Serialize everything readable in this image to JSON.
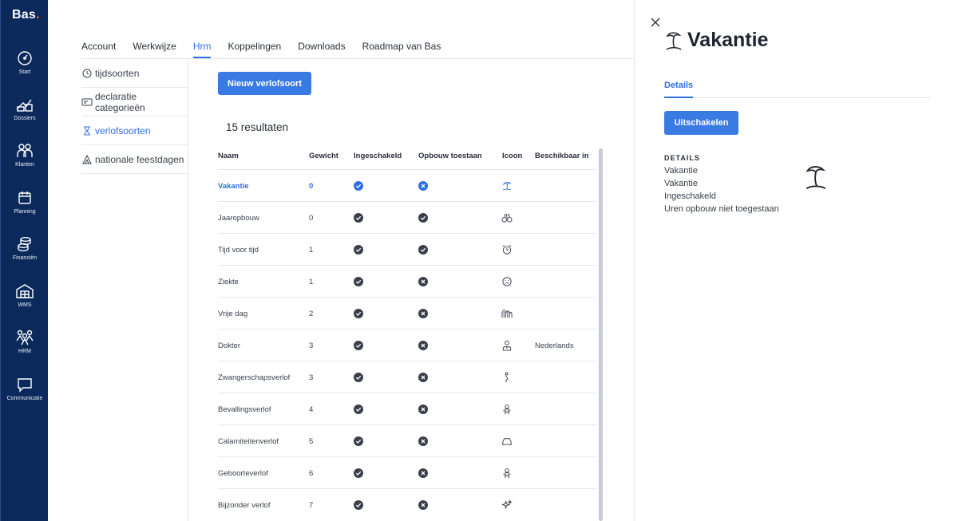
{
  "brand": {
    "logo": "Bas",
    "logo_dot": "."
  },
  "leftnav": [
    {
      "label": "Start",
      "icon": "speedometer-icon"
    },
    {
      "label": "Dossiers",
      "icon": "dossiers-icon"
    },
    {
      "label": "Klanten",
      "icon": "customers-icon"
    },
    {
      "label": "Planning",
      "icon": "calendar-icon"
    },
    {
      "label": "Financiën",
      "icon": "coins-icon"
    },
    {
      "label": "WMS",
      "icon": "warehouse-icon"
    },
    {
      "label": "HRM",
      "icon": "people-icon"
    },
    {
      "label": "Communicatie",
      "icon": "chat-icon"
    }
  ],
  "tabs": [
    "Account",
    "Werkwijze",
    "Hrm",
    "Koppelingen",
    "Downloads",
    "Roadmap van Bas"
  ],
  "active_tab": "Hrm",
  "subnav": [
    {
      "label": "tijdsoorten",
      "icon": "clock-icon"
    },
    {
      "label": "declaratie categorieën",
      "icon": "receipt-icon"
    },
    {
      "label": "verlofsoorten",
      "icon": "hourglass-icon",
      "active": true
    },
    {
      "label": "nationale feestdagen",
      "icon": "tent-icon"
    }
  ],
  "main": {
    "new_button": "Nieuw verlofsoort",
    "results": "15 resultaten",
    "columns": [
      "Naam",
      "Gewicht",
      "Ingeschakeld",
      "Opbouw toestaan",
      "Icoon",
      "Beschikbaar in"
    ],
    "rows": [
      {
        "naam": "Vakantie",
        "gewicht": "0",
        "ingeschakeld": true,
        "opbouw": false,
        "icon": "palm-tree-icon",
        "beschikbaar": "",
        "active": true
      },
      {
        "naam": "Jaaropbouw",
        "gewicht": "0",
        "ingeschakeld": true,
        "opbouw": true,
        "icon": "binoculars-icon",
        "beschikbaar": ""
      },
      {
        "naam": "Tijd voor tijd",
        "gewicht": "1",
        "ingeschakeld": true,
        "opbouw": true,
        "icon": "alarm-clock-icon",
        "beschikbaar": ""
      },
      {
        "naam": "Ziekte",
        "gewicht": "1",
        "ingeschakeld": true,
        "opbouw": false,
        "icon": "sick-face-icon",
        "beschikbaar": ""
      },
      {
        "naam": "Vrije dag",
        "gewicht": "2",
        "ingeschakeld": true,
        "opbouw": false,
        "icon": "rollercoaster-icon",
        "beschikbaar": ""
      },
      {
        "naam": "Dokter",
        "gewicht": "3",
        "ingeschakeld": true,
        "opbouw": false,
        "icon": "doctor-icon",
        "beschikbaar": "Nederlands"
      },
      {
        "naam": "Zwangerschapsverlof",
        "gewicht": "3",
        "ingeschakeld": true,
        "opbouw": false,
        "icon": "pregnant-icon",
        "beschikbaar": ""
      },
      {
        "naam": "Bevallingsverlof",
        "gewicht": "4",
        "ingeschakeld": true,
        "opbouw": false,
        "icon": "baby-icon",
        "beschikbaar": ""
      },
      {
        "naam": "Calamiteitenverlof",
        "gewicht": "5",
        "ingeschakeld": true,
        "opbouw": false,
        "icon": "ambulance-icon",
        "beschikbaar": ""
      },
      {
        "naam": "Geboorteverlof",
        "gewicht": "6",
        "ingeschakeld": true,
        "opbouw": false,
        "icon": "baby-icon",
        "beschikbaar": ""
      },
      {
        "naam": "Bijzonder verlof",
        "gewicht": "7",
        "ingeschakeld": true,
        "opbouw": false,
        "icon": "sparkles-icon",
        "beschikbaar": ""
      }
    ]
  },
  "detail": {
    "title": "Vakantie",
    "tab": "Details",
    "action_button": "Uitschakelen",
    "section_heading": "DETAILS",
    "lines": [
      "Vakantie",
      "Vakantie",
      "Ingeschakeld",
      "Uren opbouw niet toegestaan"
    ],
    "icon": "palm-tree-icon"
  },
  "colors": {
    "nav_bg": "#0b2a5b",
    "accent": "#2f6fe4",
    "button": "#3a7be3"
  }
}
